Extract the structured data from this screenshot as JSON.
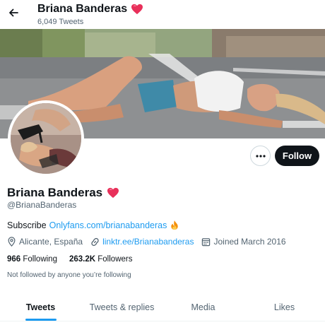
{
  "header": {
    "name": "Briana Banderas",
    "tweet_count": "6,049 Tweets",
    "heart_icon": "red-heart-emoji-icon"
  },
  "profile": {
    "display_name": "Briana Banderas",
    "handle": "@BrianaBanderas",
    "follow_label": "Follow",
    "more_icon": "ellipsis-icon"
  },
  "bio": {
    "prefix": "Subscribe ",
    "link": "Onlyfans.com/brianabanderas",
    "emoji": "fire-emoji-icon"
  },
  "meta": {
    "location": "Alicante, España",
    "website": "linktr.ee/Brianabanderas",
    "joined": "Joined March 2016"
  },
  "stats": {
    "following_count": "966",
    "following_label": "Following",
    "followers_count": "263.2K",
    "followers_label": "Followers"
  },
  "not_followed_text": "Not followed by anyone you’re following",
  "tabs": [
    {
      "label": "Tweets",
      "active": true
    },
    {
      "label": "Tweets & replies",
      "active": false
    },
    {
      "label": "Media",
      "active": false
    },
    {
      "label": "Likes",
      "active": false
    }
  ],
  "colors": {
    "accent": "#1d9bf0",
    "heart": "#e8305a",
    "text": "#0f1419",
    "muted": "#536471"
  }
}
